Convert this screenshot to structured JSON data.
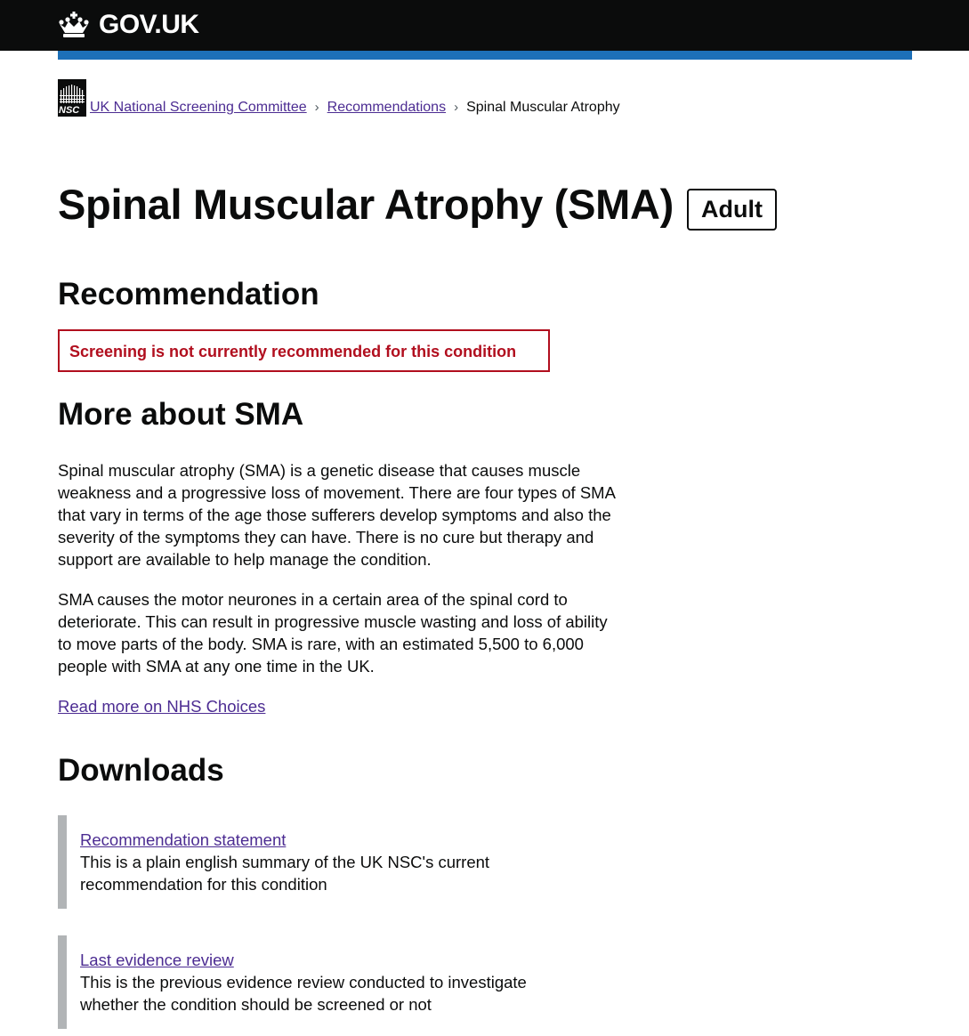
{
  "header": {
    "brand": "GOV.UK",
    "crown_icon": "crown-icon",
    "colors": {
      "background": "#0b0c0c",
      "accent_bar": "#1d70b8"
    }
  },
  "breadcrumb": {
    "logo_text": "NSC",
    "items": [
      {
        "label": "UK National Screening Committee"
      },
      {
        "label": "Recommendations"
      }
    ],
    "current": "Spinal Muscular Atrophy"
  },
  "title": {
    "text": "Spinal Muscular Atrophy (SMA)",
    "tag": "Adult"
  },
  "recommendation": {
    "heading": "Recommendation",
    "status": "Screening is not currently recommended for this condition",
    "status_color": "#b10e1e"
  },
  "more": {
    "heading": "More about SMA",
    "paragraphs": [
      "Spinal muscular atrophy (SMA) is a genetic disease that causes muscle weakness and a progressive loss of movement. There are four types of SMA that vary in terms of the age those sufferers develop symptoms and also the severity of the symptoms they can have. There is no cure but therapy and support are available to help manage the condition.",
      "SMA causes the motor neurones in a certain area of the spinal cord to deteriorate. This can result in progressive muscle wasting and loss of ability to move parts of the body. SMA is rare, with an estimated 5,500 to 6,000 people with SMA at any one time in the UK."
    ],
    "link": "Read more on NHS Choices"
  },
  "downloads": {
    "heading": "Downloads",
    "items": [
      {
        "link": "Recommendation statement",
        "description": "This is a plain english summary of the UK NSC's current recommendation for this condition"
      },
      {
        "link": "Last evidence review",
        "description": "This is the previous evidence review conducted to investigate whether the condition should be screened or not"
      }
    ]
  }
}
